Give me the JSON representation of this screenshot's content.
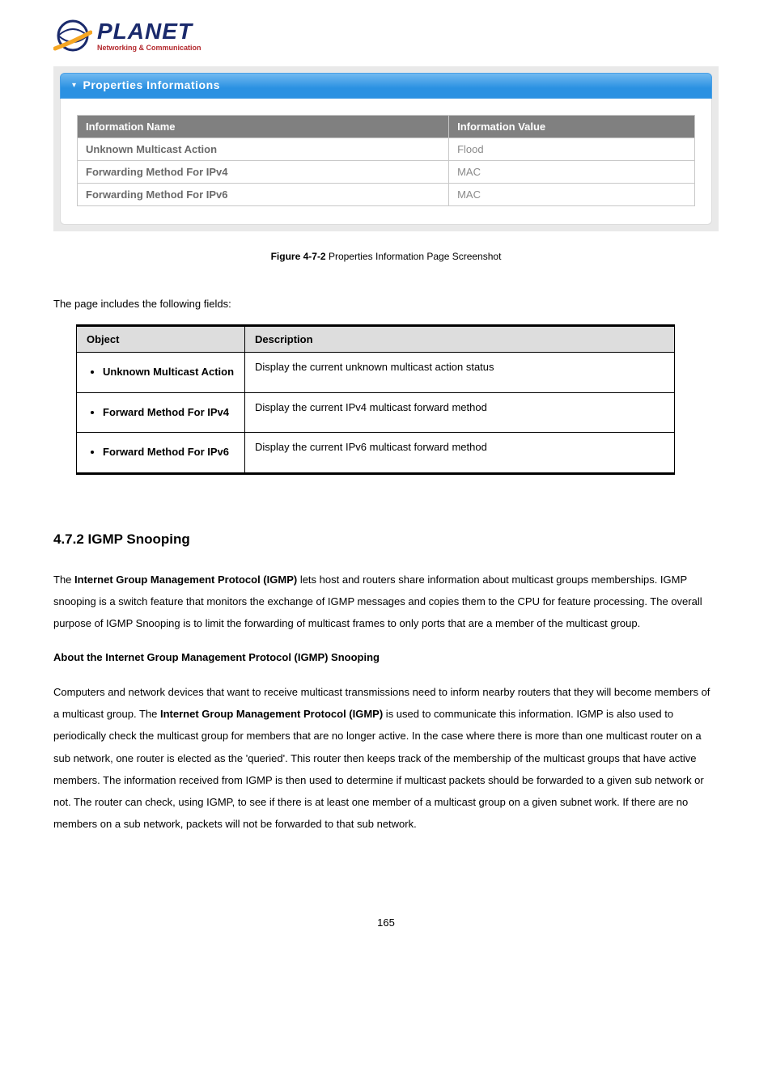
{
  "logo": {
    "brand": "PLANET",
    "tagline": "Networking & Communication"
  },
  "panel": {
    "title": "Properties Informations"
  },
  "info_table": {
    "header_name": "Information Name",
    "header_value": "Information Value",
    "rows": [
      {
        "name": "Unknown Multicast Action",
        "value": "Flood"
      },
      {
        "name": "Forwarding Method For IPv4",
        "value": "MAC"
      },
      {
        "name": "Forwarding Method For IPv6",
        "value": "MAC"
      }
    ]
  },
  "figure": {
    "label": "Figure 4-7-2",
    "caption": "Properties Information Page Screenshot"
  },
  "fields_intro": "The page includes the following fields:",
  "fields_table": {
    "header_object": "Object",
    "header_description": "Description",
    "rows": [
      {
        "object": "Unknown Multicast Action",
        "description": "Display the current unknown multicast action status"
      },
      {
        "object": "Forward Method For IPv4",
        "description": "Display the current IPv4 multicast forward method"
      },
      {
        "object": "Forward Method For IPv6",
        "description": "Display the current IPv6 multicast forward method"
      }
    ]
  },
  "section": {
    "heading": "4.7.2 IGMP Snooping",
    "para1_a": "The ",
    "para1_b": "Internet Group Management Protocol (IGMP)",
    "para1_c": " lets host and routers share information about multicast groups memberships. IGMP snooping is a switch feature that monitors the exchange of IGMP messages and copies them to the CPU for feature processing. The overall purpose of IGMP Snooping is to limit the forwarding of multicast frames to only ports that are a member of the multicast group.",
    "subheading": "About the Internet Group Management Protocol (IGMP) Snooping",
    "para2_a": "Computers and network devices that want to receive multicast transmissions need to inform nearby routers that they will become members of a multicast group. The ",
    "para2_b": "Internet Group Management Protocol (IGMP)",
    "para2_c": " is used to communicate this information. IGMP is also used to periodically check the multicast group for members that are no longer active. In the case where there is more than one multicast router on a sub network, one router is elected as the 'queried'. This router then keeps track of the membership of the multicast groups that have active members. The information received from IGMP is then used to determine if multicast packets should be forwarded to a given sub network or not. The router can check, using IGMP, to see if there is at least one member of a multicast group on a given subnet work. If there are no members on a sub network, packets will not be forwarded to that sub network."
  },
  "page_number": "165"
}
